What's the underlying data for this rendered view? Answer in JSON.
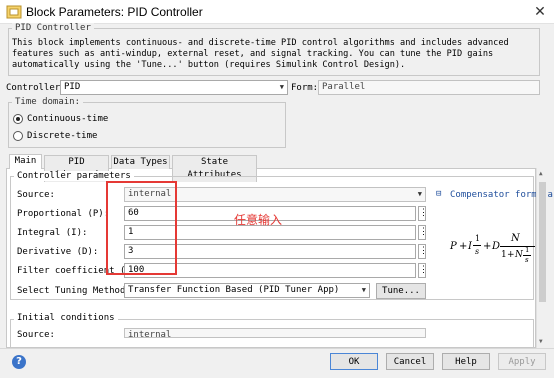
{
  "window": {
    "title": "Block Parameters: PID Controller",
    "close_glyph": "✕"
  },
  "header": {
    "block_name": "PID Controller",
    "description": "This block implements continuous- and discrete-time PID control algorithms and includes advanced features such as anti-windup, external reset, and signal tracking. You can tune the PID gains automatically using the 'Tune...' button (requires Simulink Control Design)."
  },
  "controller": {
    "label": "Controller:",
    "value": "PID",
    "form_label": "Form:",
    "form_value": "Parallel"
  },
  "time_domain": {
    "legend": "Time domain:",
    "options": [
      "Continuous-time",
      "Discrete-time"
    ],
    "selected_index": 0
  },
  "tabs": [
    "Main",
    "PID Advanced",
    "Data Types",
    "State Attributes"
  ],
  "active_tab": "Main",
  "controller_params": {
    "legend": "Controller parameters",
    "source_label": "Source:",
    "source_value": "internal",
    "compensator_toggle": "⊟",
    "compensator_label": "Compensator formula",
    "fields": [
      {
        "label": "Proportional (P):",
        "value": "60"
      },
      {
        "label": "Integral (I):",
        "value": "1"
      },
      {
        "label": "Derivative (D):",
        "value": "3"
      },
      {
        "label": "Filter coefficient (N):",
        "value": "100"
      }
    ],
    "dots_label": "⋮",
    "tuning_label": "Select Tuning Method:",
    "tuning_value": "Transfer Function Based (PID Tuner App)",
    "tune_button": "Tune..."
  },
  "annotation": {
    "text": "任意输入",
    "color": "#e53935"
  },
  "formula": {
    "p": "P",
    "plus1": "+",
    "i": "I",
    "n1": "1",
    "s1": "s",
    "plus2": "+",
    "d": "D",
    "n_top": "N",
    "one": "1",
    "plus3": "+",
    "n": "N",
    "n2": "1",
    "s2": "s"
  },
  "initial_conditions": {
    "legend": "Initial conditions",
    "source_label": "Source:",
    "source_value": "internal"
  },
  "buttons": {
    "help_icon": "?",
    "ok": "OK",
    "cancel": "Cancel",
    "help": "Help",
    "apply": "Apply"
  },
  "colors": {
    "accent": "#4b86d6",
    "annotation": "#e53935",
    "background": "#f0f0f0",
    "link": "#1f4e9c"
  }
}
